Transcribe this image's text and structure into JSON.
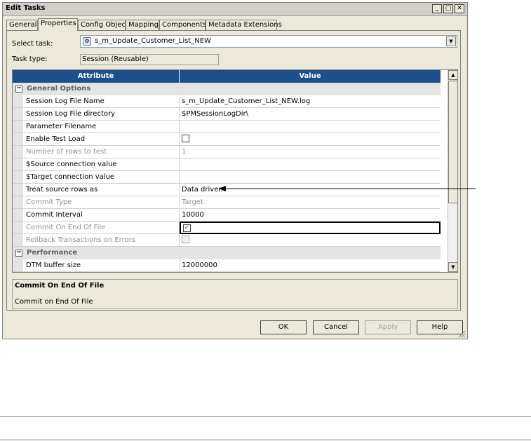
{
  "window": {
    "title": "Edit Tasks",
    "minimize": "_",
    "maximize": "□",
    "close": "✕"
  },
  "tabs": [
    {
      "label": "General",
      "active": false
    },
    {
      "label": "Properties",
      "active": true
    },
    {
      "label": "Config Object",
      "active": false
    },
    {
      "label": "Mapping",
      "active": false
    },
    {
      "label": "Components",
      "active": false
    },
    {
      "label": "Metadata Extensions",
      "active": false
    }
  ],
  "form": {
    "select_task_label": "Select task:",
    "select_task_value": "s_m_Update_Customer_List_NEW",
    "task_type_label": "Task type:",
    "task_type_value": "Session (Reusable)"
  },
  "grid": {
    "col_attribute": "Attribute",
    "col_value": "Value",
    "group_general": "General Options",
    "group_performance": "Performance",
    "rows": [
      {
        "attr": "Session Log File Name",
        "value": "s_m_Update_Customer_List_NEW.log"
      },
      {
        "attr": "Session Log File directory",
        "value": "$PMSessionLogDir\\"
      },
      {
        "attr": "Parameter Filename",
        "value": ""
      },
      {
        "attr": "Enable Test Load",
        "value": ""
      },
      {
        "attr": "Number of rows to test",
        "value": "1"
      },
      {
        "attr": "$Source connection value",
        "value": ""
      },
      {
        "attr": "$Target connection value",
        "value": ""
      },
      {
        "attr": "Treat source rows as",
        "value": "Data driven"
      },
      {
        "attr": "Commit Type",
        "value": "Target"
      },
      {
        "attr": "Commit Interval",
        "value": "10000"
      },
      {
        "attr": "Commit On End Of File",
        "value": ""
      },
      {
        "attr": "Rollback Transactions on Errors",
        "value": ""
      }
    ],
    "perf_rows": [
      {
        "attr": "DTM buffer size",
        "value": "12000000"
      }
    ]
  },
  "checkboxes": {
    "enable_test_load": false,
    "commit_on_end_of_file": true,
    "rollback_transactions": false
  },
  "description": {
    "title": "Commit On End Of File",
    "text": "Commit on End Of File"
  },
  "buttons": {
    "ok": "OK",
    "cancel": "Cancel",
    "apply": "Apply",
    "help": "Help"
  }
}
